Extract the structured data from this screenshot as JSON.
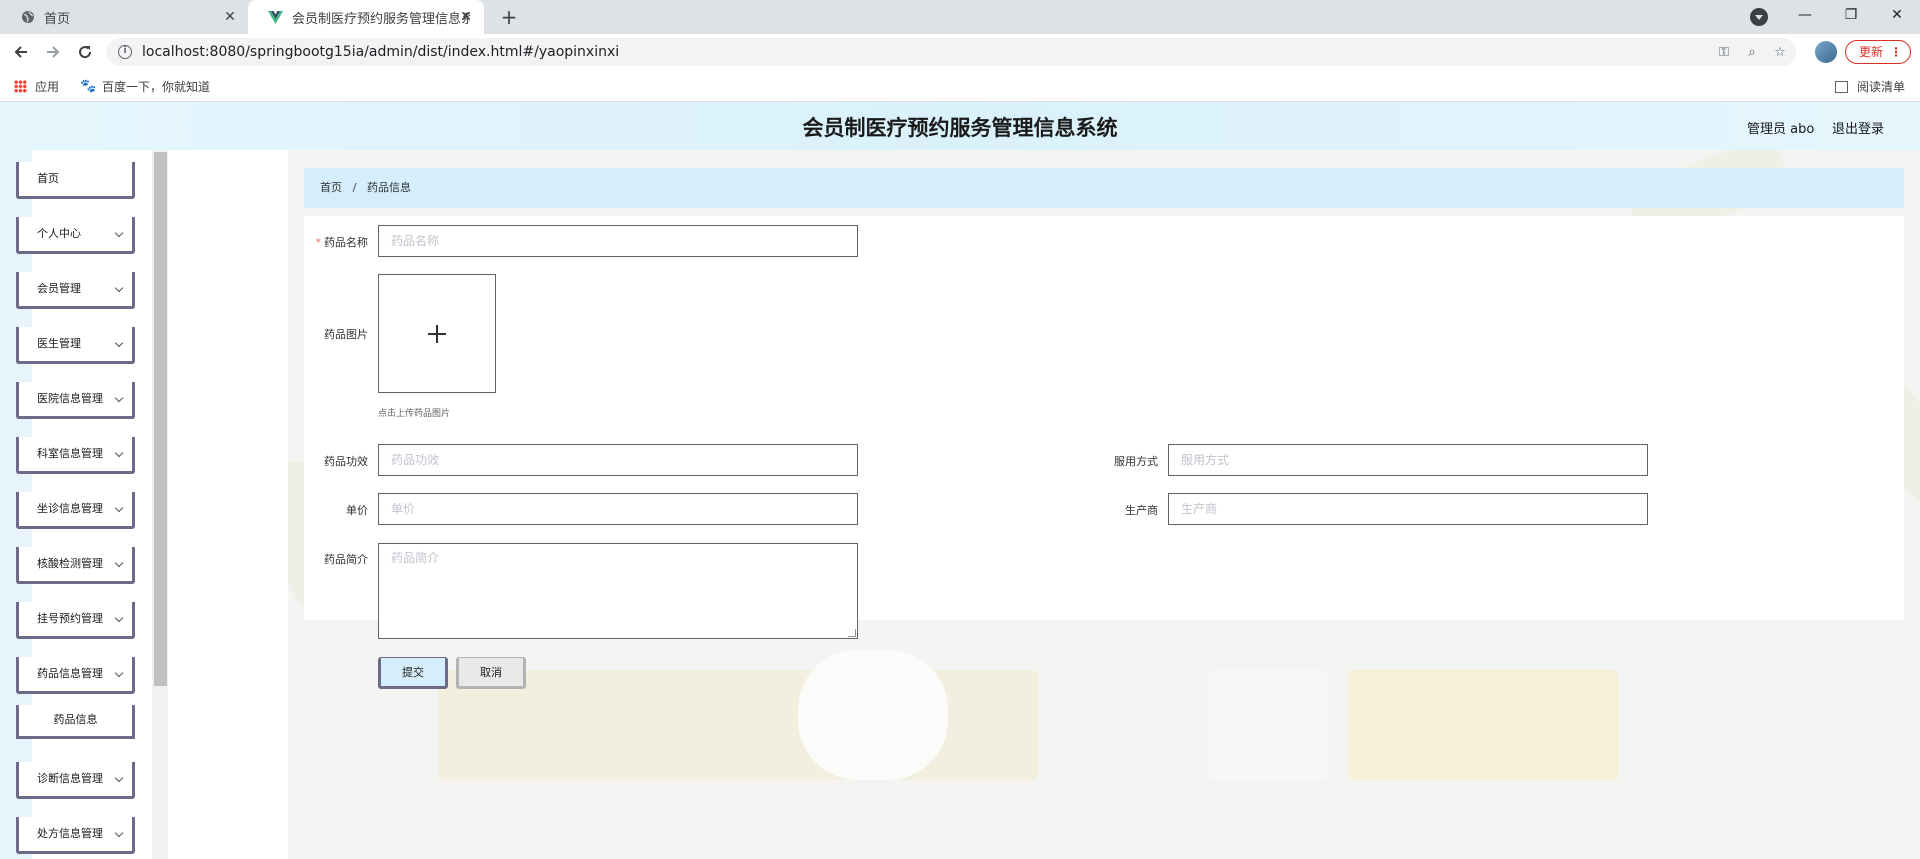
{
  "browser": {
    "tabs": [
      {
        "title": "首页",
        "active": false
      },
      {
        "title": "会员制医疗预约服务管理信息系统",
        "active": true
      }
    ],
    "url": "localhost:8080/springbootg15ia/admin/dist/index.html#/yaopinxinxi",
    "update_label": "更新",
    "bookmarks": [
      {
        "label": "应用",
        "icon": "apps-icon"
      },
      {
        "label": "百度一下，你就知道",
        "icon": "baidu-paw-icon"
      }
    ],
    "reading_list_label": "阅读清单"
  },
  "app": {
    "title": "会员制医疗预约服务管理信息系统",
    "user_label": "管理员 abo",
    "logout_label": "退出登录"
  },
  "sidebar": {
    "items": [
      {
        "label": "首页",
        "has_children": false
      },
      {
        "label": "个人中心",
        "has_children": true
      },
      {
        "label": "会员管理",
        "has_children": true
      },
      {
        "label": "医生管理",
        "has_children": true
      },
      {
        "label": "医院信息管理",
        "has_children": true
      },
      {
        "label": "科室信息管理",
        "has_children": true
      },
      {
        "label": "坐诊信息管理",
        "has_children": true
      },
      {
        "label": "核酸检测管理",
        "has_children": true
      },
      {
        "label": "挂号预约管理",
        "has_children": true
      },
      {
        "label": "药品信息管理",
        "has_children": true,
        "expanded": true
      },
      {
        "label": "诊断信息管理",
        "has_children": true
      },
      {
        "label": "处方信息管理",
        "has_children": true
      }
    ],
    "sub_item": "药品信息"
  },
  "breadcrumb": {
    "home": "首页",
    "separator": "/",
    "current": "药品信息"
  },
  "form": {
    "name": {
      "label": "药品名称",
      "placeholder": "药品名称",
      "required": true,
      "value": ""
    },
    "image": {
      "label": "药品图片",
      "tip": "点击上传药品图片"
    },
    "efficacy": {
      "label": "药品功效",
      "placeholder": "药品功效",
      "value": ""
    },
    "usage": {
      "label": "服用方式",
      "placeholder": "服用方式",
      "value": ""
    },
    "price": {
      "label": "单价",
      "placeholder": "单价",
      "value": ""
    },
    "manufacturer": {
      "label": "生产商",
      "placeholder": "生产商",
      "value": ""
    },
    "intro": {
      "label": "药品简介",
      "placeholder": "药品简介",
      "value": ""
    },
    "submit_label": "提交",
    "cancel_label": "取消"
  },
  "colors": {
    "header_bg": "#d9f1fb",
    "breadcrumb_bg": "#d4effb",
    "menu_border": "#6d6a8a",
    "required_mark": "#f56c6c",
    "update_red": "#d93025"
  }
}
